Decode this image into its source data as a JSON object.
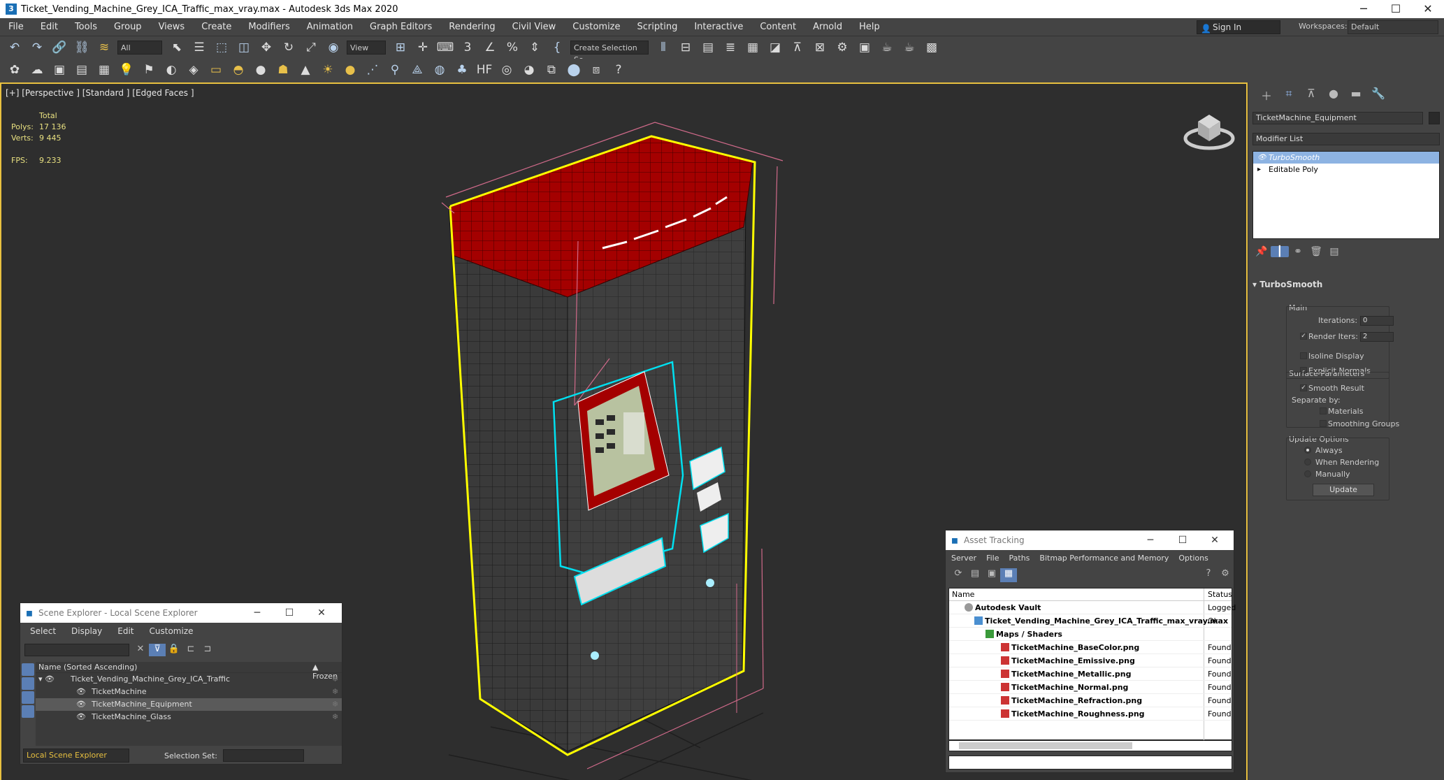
{
  "window": {
    "title": "Ticket_Vending_Machine_Grey_ICA_Traffic_max_vray.max - Autodesk 3ds Max 2020",
    "minimize": "─",
    "maximize": "☐",
    "close": "✕"
  },
  "menu": {
    "items": [
      "File",
      "Edit",
      "Tools",
      "Group",
      "Views",
      "Create",
      "Modifiers",
      "Animation",
      "Graph Editors",
      "Rendering",
      "Civil View",
      "Customize",
      "Scripting",
      "Interactive",
      "Content",
      "Arnold",
      "Help"
    ],
    "sign_in": "Sign In",
    "workspaces_label": "Workspaces:",
    "workspaces_value": "Default"
  },
  "toolbar": {
    "selection_filter": "All",
    "ref_coord": "View",
    "named_selection": "Create Selection Se"
  },
  "viewport": {
    "label": "[+] [Perspective ] [Standard ] [Edged Faces ]",
    "stats": {
      "header": "Total",
      "polys_label": "Polys:",
      "polys": "17 136",
      "verts_label": "Verts:",
      "verts": "9 445",
      "fps_label": "FPS:",
      "fps": "9.233"
    }
  },
  "command_panel": {
    "object_name": "TicketMachine_Equipment",
    "modifier_list": "Modifier List",
    "stack": [
      {
        "label": "TurboSmooth",
        "selected": true,
        "marker": "👁"
      },
      {
        "label": "Editable Poly",
        "selected": false,
        "marker": "▸"
      }
    ],
    "rollout_title": "TurboSmooth",
    "main_label": "Main",
    "iterations_label": "Iterations:",
    "iterations": "0",
    "render_iters_label": "Render Iters:",
    "render_iters": "2",
    "isoline_label": "Isoline Display",
    "explicit_label": "Explicit Normals",
    "surface_label": "Surface Parameters",
    "smooth_result_label": "Smooth Result",
    "separate_label": "Separate by:",
    "materials_label": "Materials",
    "smoothing_groups_label": "Smoothing Groups",
    "update_options_label": "Update Options",
    "always_label": "Always",
    "when_rendering_label": "When Rendering",
    "manually_label": "Manually",
    "update_button": "Update"
  },
  "scene_explorer": {
    "title": "Scene Explorer - Local Scene Explorer",
    "menu": [
      "Select",
      "Display",
      "Edit",
      "Customize"
    ],
    "col_name": "Name (Sorted Ascending)",
    "col_frozen": "▲ Frozen",
    "rows": [
      {
        "name": "Ticket_Vending_Machine_Grey_ICA_Traffic"
      },
      {
        "name": "TicketMachine"
      },
      {
        "name": "TicketMachine_Equipment"
      },
      {
        "name": "TicketMachine_Glass"
      }
    ],
    "explorer_dropdown": "Local Scene Explorer",
    "selection_set_label": "Selection Set:"
  },
  "asset_tracking": {
    "title": "Asset Tracking",
    "menu": [
      "Server",
      "File",
      "Paths",
      "Bitmap Performance and Memory",
      "Options"
    ],
    "col_name": "Name",
    "col_status": "Status",
    "rows": [
      {
        "name": "Autodesk Vault",
        "status": "Logged"
      },
      {
        "name": "Ticket_Vending_Machine_Grey_ICA_Traffic_max_vray.max",
        "status": "Ok"
      },
      {
        "name": "Maps / Shaders",
        "status": ""
      },
      {
        "name": "TicketMachine_BaseColor.png",
        "status": "Found"
      },
      {
        "name": "TicketMachine_Emissive.png",
        "status": "Found"
      },
      {
        "name": "TicketMachine_Metallic.png",
        "status": "Found"
      },
      {
        "name": "TicketMachine_Normal.png",
        "status": "Found"
      },
      {
        "name": "TicketMachine_Refraction.png",
        "status": "Found"
      },
      {
        "name": "TicketMachine_Roughness.png",
        "status": "Found"
      }
    ]
  }
}
